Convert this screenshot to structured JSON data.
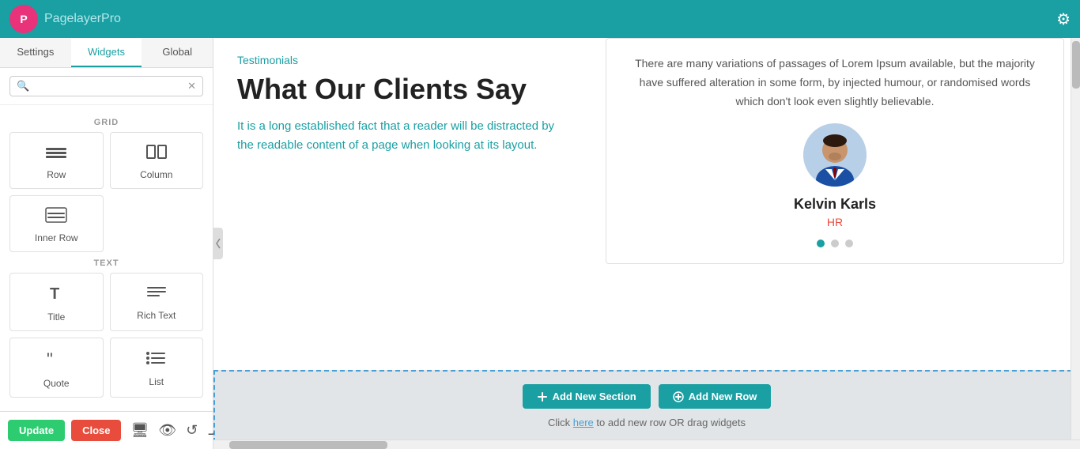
{
  "header": {
    "logo_letter": "P",
    "title": "Pagelayer",
    "title_suffix": "Pro",
    "gear_icon": "⚙"
  },
  "sidebar": {
    "tabs": [
      {
        "id": "settings",
        "label": "Settings"
      },
      {
        "id": "widgets",
        "label": "Widgets",
        "active": true
      },
      {
        "id": "global",
        "label": "Global"
      }
    ],
    "search": {
      "placeholder": "",
      "clear_icon": "✕",
      "search_icon": "🔍"
    },
    "sections": [
      {
        "id": "grid",
        "label": "GRID",
        "widgets": [
          {
            "id": "row",
            "icon": "≡",
            "label": "Row"
          },
          {
            "id": "column",
            "icon": "⬜",
            "label": "Column"
          },
          {
            "id": "inner-row",
            "icon": "⊞",
            "label": "Inner Row"
          }
        ]
      },
      {
        "id": "text",
        "label": "TEXT",
        "widgets": [
          {
            "id": "title",
            "icon": "T",
            "label": "Title"
          },
          {
            "id": "rich-text",
            "icon": "≡",
            "label": "Rich Text"
          },
          {
            "id": "quote",
            "icon": "❝",
            "label": "Quote"
          },
          {
            "id": "list",
            "icon": "≔",
            "label": "List"
          }
        ]
      }
    ]
  },
  "bottom_bar": {
    "update_label": "Update",
    "close_label": "Close"
  },
  "canvas": {
    "testimonials": {
      "section_label": "Testimonials",
      "heading": "What Our Clients Say",
      "subtext": "It is a long established fact that a reader will be distracted by the readable content of a page when looking at its layout.",
      "card": {
        "body_text": "There are many variations of passages of Lorem Ipsum available, but the majority have suffered alteration in some form, by injected humour, or randomised words which don't look even slightly believable.",
        "name": "Kelvin Karls",
        "role": "HR",
        "dots": [
          true,
          false,
          false
        ]
      }
    },
    "add_section": {
      "add_section_label": "Add New Section",
      "add_row_label": "Add New Row",
      "hint_prefix": "Click here ",
      "hint_here": "here",
      "hint_suffix": " to add new row OR drag widgets"
    }
  }
}
